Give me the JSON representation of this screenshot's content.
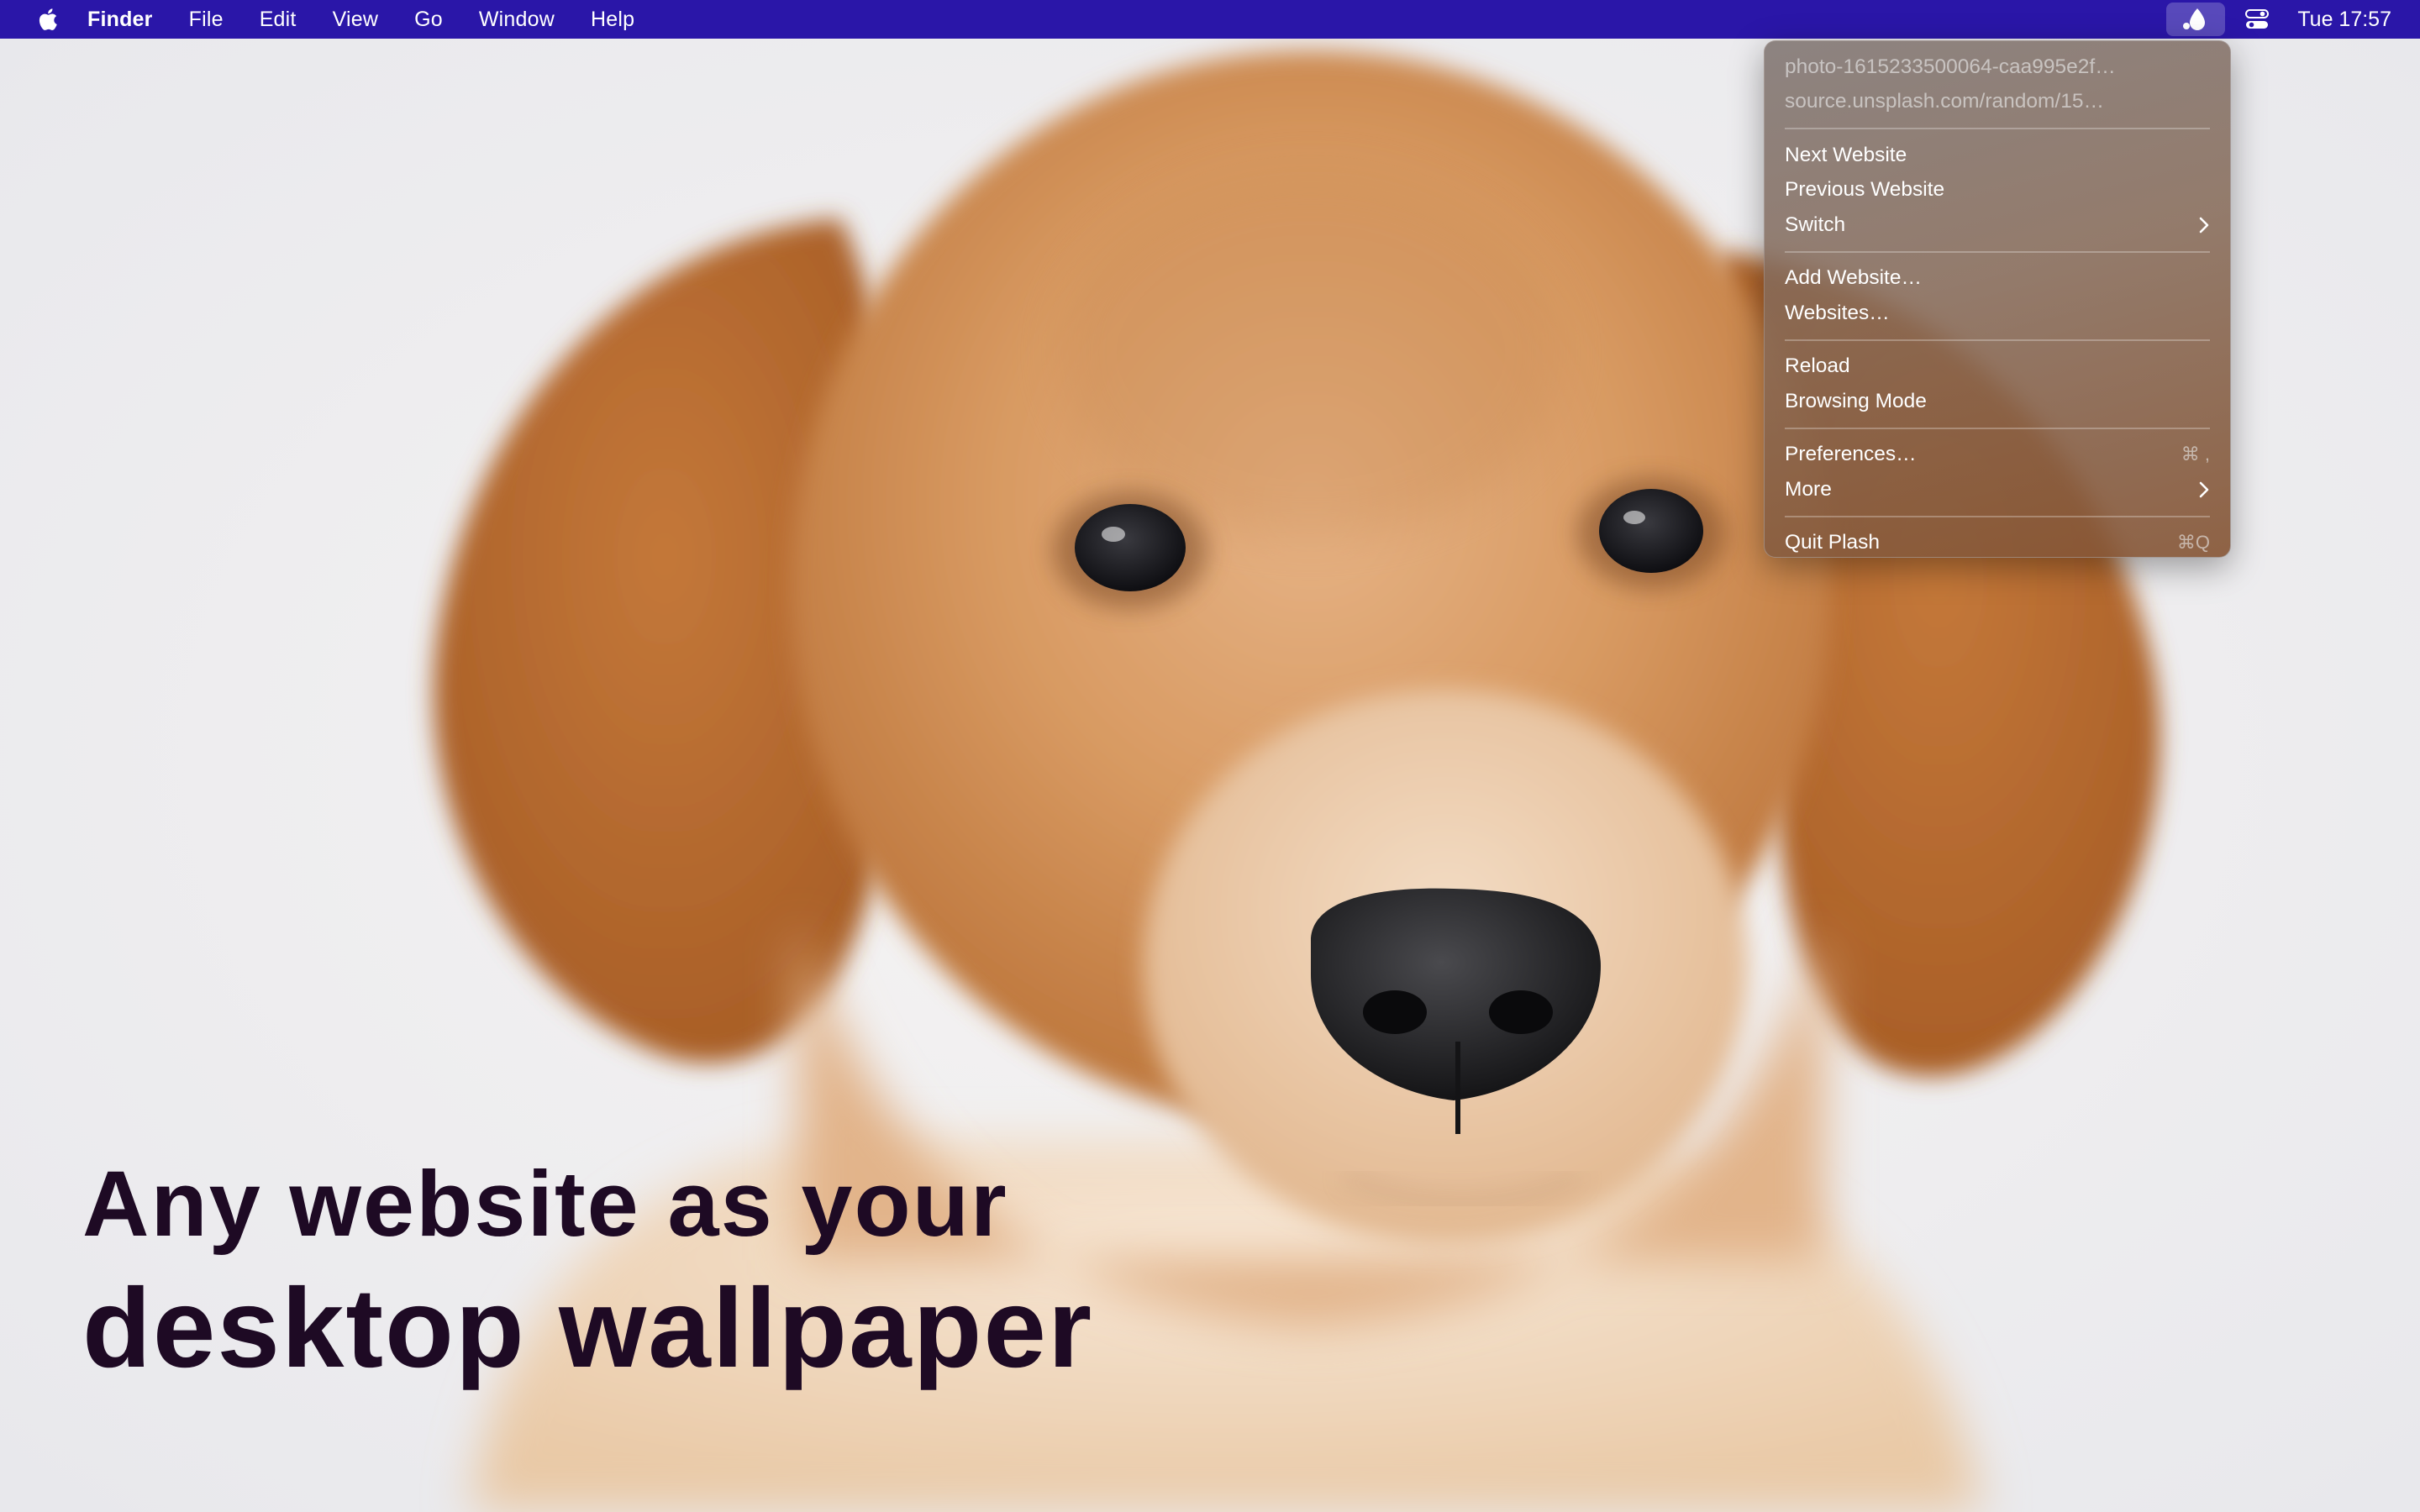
{
  "menubar": {
    "app_name": "Finder",
    "menus": [
      "File",
      "Edit",
      "View",
      "Go",
      "Window",
      "Help"
    ],
    "clock": "Tue 17:57",
    "background": "#2a16a8"
  },
  "dropdown": {
    "info_title": "photo-1615233500064-caa995e2f…",
    "info_url": "source.unsplash.com/random/15…",
    "next_website": "Next Website",
    "previous_website": "Previous Website",
    "switch": "Switch",
    "add_website": "Add Website…",
    "websites": "Websites…",
    "reload": "Reload",
    "browsing_mode": "Browsing Mode",
    "preferences": "Preferences…",
    "preferences_shortcut": "⌘ ,",
    "more": "More",
    "quit": "Quit Plash",
    "quit_shortcut": "⌘Q"
  },
  "headline": {
    "line1": "Any website as your",
    "line2": "desktop wallpaper",
    "color": "#1e0a24"
  },
  "icons": [
    "apple-logo-icon",
    "plash-drop-icon",
    "control-center-icon",
    "chevron-right-icon"
  ]
}
